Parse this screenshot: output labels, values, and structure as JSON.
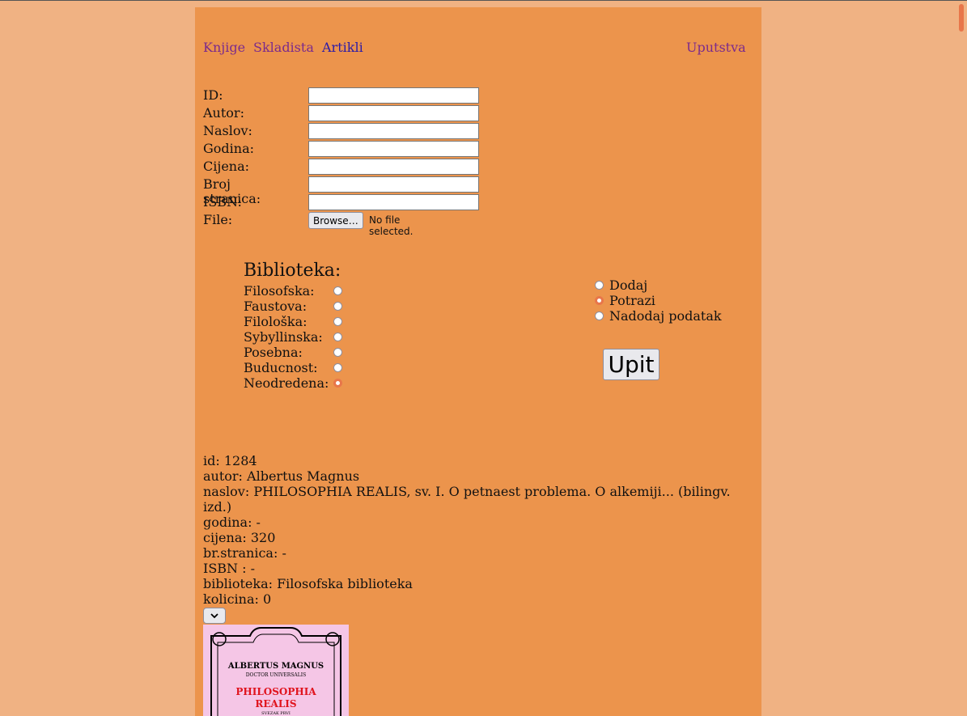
{
  "nav": {
    "links": [
      {
        "label": "Knjige"
      },
      {
        "label": "Skladista"
      },
      {
        "label": "Artikli"
      }
    ],
    "help_label": "Uputstva"
  },
  "form": {
    "fields": [
      {
        "label": "ID:",
        "value": ""
      },
      {
        "label": "Autor:",
        "value": ""
      },
      {
        "label": "Naslov:",
        "value": ""
      },
      {
        "label": "Godina:",
        "value": ""
      },
      {
        "label": "Cijena:",
        "value": ""
      },
      {
        "label": "Broj stranica:",
        "value": ""
      },
      {
        "label": "ISBN:",
        "value": ""
      }
    ],
    "file_label": "File:",
    "browse_label": "Browse…",
    "file_status": "No file selected."
  },
  "biblioteka": {
    "title": "Biblioteka:",
    "options": [
      {
        "label": "Filosofska:",
        "checked": false
      },
      {
        "label": "Faustova:",
        "checked": false
      },
      {
        "label": "Filološka:",
        "checked": false
      },
      {
        "label": "Sybyllinska:",
        "checked": false
      },
      {
        "label": "Posebna:",
        "checked": false
      },
      {
        "label": "Buducnost:",
        "checked": false
      },
      {
        "label": "Neodredena:",
        "checked": true
      }
    ]
  },
  "actions": {
    "options": [
      {
        "label": "Dodaj",
        "checked": false
      },
      {
        "label": "Potrazi",
        "checked": true
      },
      {
        "label": "Nadodaj podatak",
        "checked": false
      }
    ],
    "submit_label": "Upit"
  },
  "result": {
    "lines": [
      "id: 1284",
      "autor: Albertus Magnus",
      "naslov: PHILOSOPHIA REALIS, sv. I. O petnaest problema. O alkemiji... (bilingv. izd.)",
      "godina: -",
      "cijena: 320",
      "br.stranica: -",
      "ISBN : -",
      "biblioteka: Filosofska biblioteka",
      "kolicina: 0"
    ],
    "cover": {
      "author": "ALBERTUS MAGNUS",
      "subtitle": "DOCTOR UNIVERSALIS",
      "title_1": "PHILOSOPHIA",
      "title_2": "REALIS",
      "volume": "SVEZAK PRVI"
    }
  },
  "colors": {
    "background": "#f0b283",
    "panel": "#ec944c",
    "radio_accent": "#e8764a",
    "visited_link": "#7b2a8c",
    "active_link": "#2a1aa8",
    "cover_bg": "#f5c6e6",
    "cover_title": "#e0141e"
  }
}
